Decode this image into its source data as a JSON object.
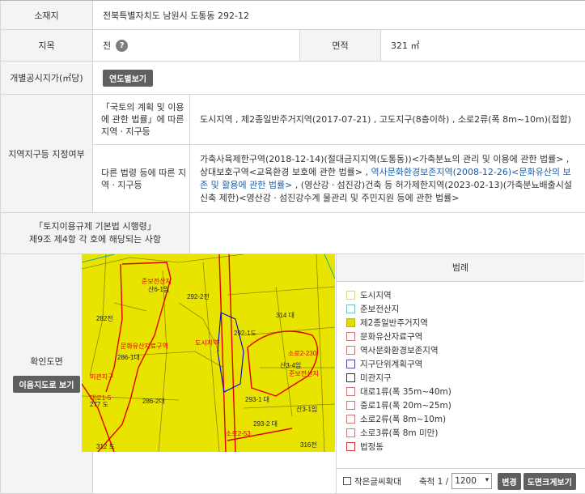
{
  "location": {
    "label": "소재지",
    "value": "전북특별자치도 남원시 도통동 292-12"
  },
  "land": {
    "category_label": "지목",
    "category_value": "전",
    "area_label": "면적",
    "area_value": "321 ㎡"
  },
  "price": {
    "label": "개별공시지가(㎡당)",
    "button": "연도별보기"
  },
  "zoning": {
    "label": "지역지구등 지정여부",
    "national_label": "「국토의 계획 및 이용에 관한 법률」에 따른 지역ㆍ지구등",
    "national_value": "도시지역 , 제2종일반주거지역(2017-07-21) , 고도지구(8층이하) , 소로2류(폭 8m~10m)(접합)",
    "other_label": "다른 법령 등에 따른 지역ㆍ지구등",
    "other_value_a": "가축사육제한구역(2018-12-14)(절대금지지역(도통동))<가축분뇨의 관리 및 이용에 관한 법률> , 상대보호구역<교육환경 보호에 관한 법률> , ",
    "other_value_b": "역사문화환경보존지역(2008-12-26)<문화유산의 보존 및 활용에 관한 법률>",
    "other_value_c": " , (영산강ㆍ섬진강)건축 등 허가제한지역(2023-02-13)(가축분뇨배출시설 신축 제한)<영산강ㆍ섬진강수계 물관리 및 주민지원 등에 관한 법률>"
  },
  "article": {
    "label_line1": "「토지이용규제 기본법 시행령」",
    "label_line2": "제9조 제4항 각 호에 해당되는 사항",
    "value": ""
  },
  "map_section": {
    "label": "확인도면",
    "button": "이음지도로 보기",
    "map_labels": [
      "준보전산지",
      "산6-1임",
      "292-2전",
      "314 대",
      "282전",
      "문화유산자료구역",
      "도시지역",
      "286-1대",
      "미관지구",
      "대로1-5",
      "277 도",
      "286-2대",
      "292-1도",
      "소로2-230",
      "산3-4임",
      "준보전산지",
      "293-1 대",
      "산3-1임",
      "293-2 대",
      "소로2-53",
      "312 도",
      "316전"
    ]
  },
  "legend": {
    "title": "범례",
    "items": [
      {
        "label": "도시지역",
        "color": "#d9d96a",
        "fill": "#ffffff"
      },
      {
        "label": "준보전산지",
        "color": "#6ac2c2",
        "fill": "#ffffff"
      },
      {
        "label": "제2종일반주거지역",
        "color": "#b8b800",
        "fill": "#e0de00"
      },
      {
        "label": "문화유산자료구역",
        "color": "#c87a7a",
        "fill": "#ffffff"
      },
      {
        "label": "역사문화환경보존지역",
        "color": "#c87a7a",
        "fill": "#ffffff"
      },
      {
        "label": "지구단위계획구역",
        "color": "#4a4aa8",
        "fill": "#ffffff"
      },
      {
        "label": "미관지구",
        "color": "#333333",
        "fill": "#ffffff"
      },
      {
        "label": "대로1류(폭 35m~40m)",
        "color": "#c87a7a",
        "fill": "#ffffff"
      },
      {
        "label": "중로1류(폭 20m~25m)",
        "color": "#c87a7a",
        "fill": "#ffffff"
      },
      {
        "label": "소로2류(폭 8m~10m)",
        "color": "#c87a7a",
        "fill": "#ffffff"
      },
      {
        "label": "소로3류(폭 8m 미만)",
        "color": "#c87a7a",
        "fill": "#ffffff"
      },
      {
        "label": "법정동",
        "color": "#c83a3a",
        "fill": "#ffffff"
      }
    ],
    "small_font_label": "작은글씨확대",
    "scale_label": "축척 1 /",
    "scale_value": "1200",
    "change_button": "변경",
    "print_button": "도면크게보기"
  }
}
